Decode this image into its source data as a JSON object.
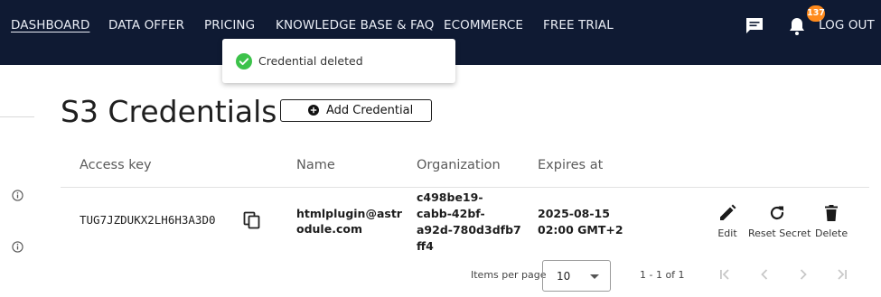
{
  "nav": {
    "items": [
      {
        "label": "DASHBOARD",
        "active": true
      },
      {
        "label": "DATA OFFER"
      },
      {
        "label": "PRICING"
      },
      {
        "label": "KNOWLEDGE BASE & FAQ"
      },
      {
        "label": "ECOMMERCE"
      },
      {
        "label": "FREE TRIAL"
      }
    ],
    "notification_count": "137",
    "logout_label": "LOG OUT",
    "icons": [
      "chat-icon",
      "bell-icon"
    ],
    "background": "#0f1a33"
  },
  "toast": {
    "message": "Credential deleted",
    "icon": "check-circle-icon",
    "icon_color": "#3cc24a"
  },
  "page": {
    "title": "S3 Credentials",
    "add_button_label": "Add Credential"
  },
  "table": {
    "headers": [
      "Access key",
      "Name",
      "Organization",
      "Expires at"
    ],
    "rows": [
      {
        "access_key": "TUG7JZDUKX2LH6H3A3D0",
        "name_line1": "htmlplugin@astr",
        "name_line2": "odule.com",
        "org_line1": "c498be19-",
        "org_line2": "cabb-42bf-",
        "org_line3": "a92d-780d3dfb7",
        "org_line4": "ff4",
        "expires_line1": "2025-08-15",
        "expires_line2": "02:00 GMT+2",
        "actions": {
          "edit": "Edit",
          "reset": "Reset Secret",
          "delete": "Delete"
        }
      }
    ]
  },
  "paginator": {
    "items_per_page_label": "Items per page",
    "page_size": "10",
    "range_label": "1 - 1 of 1"
  }
}
